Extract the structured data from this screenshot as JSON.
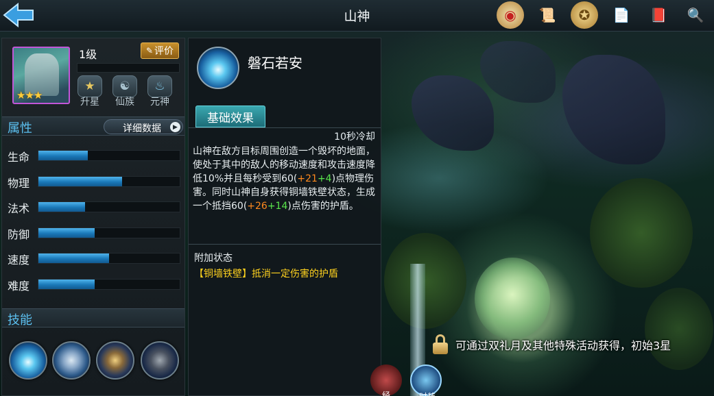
{
  "header": {
    "title": "山神",
    "icons": [
      "event-icon",
      "scroll-icon",
      "medal-icon",
      "notice-icon",
      "book-icon",
      "magnifier-icon"
    ]
  },
  "hero": {
    "level": "1级",
    "rate_label": "评价",
    "stars": "★★★",
    "badges": [
      {
        "label": "升星",
        "icon": "star-up-icon"
      },
      {
        "label": "仙族",
        "icon": "clan-icon"
      },
      {
        "label": "元神",
        "icon": "spirit-icon"
      }
    ]
  },
  "attributes": {
    "title": "属性",
    "detail_label": "详细数据",
    "items": [
      {
        "label": "生命",
        "fill": 0.35
      },
      {
        "label": "物理",
        "fill": 0.59
      },
      {
        "label": "法术",
        "fill": 0.33
      },
      {
        "label": "防御",
        "fill": 0.4
      },
      {
        "label": "速度",
        "fill": 0.5
      },
      {
        "label": "难度",
        "fill": 0.4
      }
    ]
  },
  "skills": {
    "title": "技能",
    "items": [
      "skill-1-icon",
      "skill-2-icon",
      "skill-3-icon",
      "skill-4-icon"
    ]
  },
  "skill_detail": {
    "name": "磐石若安",
    "tab_label": "基础效果",
    "cooldown": "10秒冷却",
    "desc_1": "山神在敌方目标周围创造一个毁坏的地面，使处于其中的敌人的移动速度和攻击速度降低10%并且每秒受到60(",
    "desc_bonus_1a": "+21",
    "desc_bonus_1b": "+4",
    "desc_2": ")点物理伤害。同时山神自身获得铜墙铁壁状态，生成一个抵挡60(",
    "desc_bonus_2a": "+26",
    "desc_bonus_2b": "+14",
    "desc_3": ")点伤害的护盾。",
    "extra_title": "附加状态",
    "extra_status": "【铜墙铁壁】抵消一定伤害的护盾"
  },
  "unlock_text": "可通过双礼月及其他特殊活动获得，初始3星",
  "bottom_tabs": [
    {
      "label": "经",
      "icon": "mask-icon"
    },
    {
      "label": "时装",
      "icon": "fashion-icon"
    }
  ],
  "colors": {
    "accent_blue": "#5cc0f0",
    "bonus_orange": "#ff8a1e",
    "bonus_green": "#5ae64c",
    "status_yellow": "#ffd21e"
  }
}
